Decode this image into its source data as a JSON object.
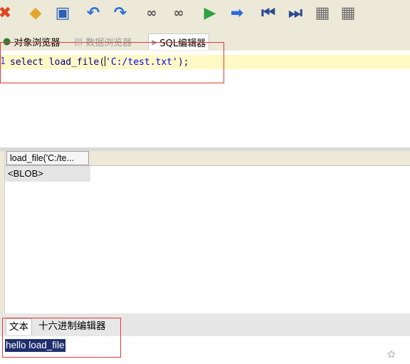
{
  "toolbar": {
    "icons": [
      {
        "name": "close-icon",
        "glyph": "✖",
        "color": "#e0441e"
      },
      {
        "name": "open-icon",
        "glyph": "📂",
        "color": "#e2a72c"
      },
      {
        "name": "save-icon",
        "glyph": "💾",
        "color": "#2a5fb5"
      },
      {
        "name": "undo-icon",
        "glyph": "↶",
        "color": "#2a6fd6"
      },
      {
        "name": "redo-icon",
        "glyph": "↷",
        "color": "#2a6fd6"
      },
      {
        "name": "find-icon",
        "glyph": "🔭",
        "color": "#555555"
      },
      {
        "name": "find-replace-icon",
        "glyph": "🔭",
        "color": "#555555"
      },
      {
        "name": "run-icon",
        "glyph": "▶",
        "color": "#2ea043"
      },
      {
        "name": "run-selection-icon",
        "glyph": "▶",
        "color": "#2c6be0"
      },
      {
        "name": "first-icon",
        "glyph": "⏮",
        "color": "#2b4a8f"
      },
      {
        "name": "last-icon",
        "glyph": "⏭",
        "color": "#2b4a8f"
      },
      {
        "name": "add-row-icon",
        "glyph": "▦",
        "color": "#6b6b6b"
      },
      {
        "name": "delete-row-icon",
        "glyph": "▦",
        "color": "#6b6b6b"
      }
    ]
  },
  "tabs": {
    "object_browser": "对象浏览器",
    "data_browser": "数据浏览器",
    "sql_editor": "SQL编辑器"
  },
  "editor": {
    "line_number": "1",
    "code_kw": "select load_file(",
    "code_str": "'C:/test.txt'",
    "code_end": ");"
  },
  "results": {
    "column_header": "load_file('C:/te...",
    "cell_value": "<BLOB>"
  },
  "bottom_tabs": {
    "text": "文本",
    "hex_editor": "十六进制编辑器"
  },
  "text_view": {
    "content": "hello load_file"
  },
  "colors": {
    "highlight_line": "#fff9c4",
    "annotation_red": "#e53935",
    "selection": "#1e2f6d"
  }
}
